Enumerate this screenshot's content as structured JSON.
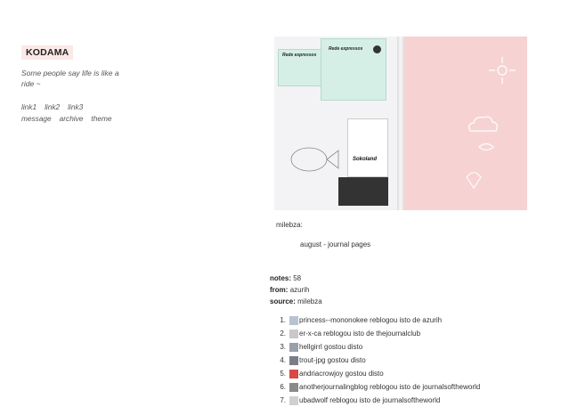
{
  "sidebar": {
    "title": "KODAMA",
    "description": "Some people say life is like a ride ~",
    "links_row1": [
      "link1",
      "link2",
      "link3"
    ],
    "links_row2": [
      "message",
      "archive",
      "theme"
    ]
  },
  "post": {
    "ticket_brand": "Rede expressos",
    "signature": "Sokoland",
    "author": "milebza:",
    "caption": "august - journal pages",
    "colors": {
      "right_page": "#f6d3d2",
      "ticket": "#d5efe6"
    }
  },
  "meta": {
    "notes_label": "notes:",
    "notes_value": "58",
    "from_label": "from:",
    "from_value": "azurih",
    "source_label": "source:",
    "source_value": "milebza"
  },
  "notes": [
    {
      "num": "1.",
      "text": "princess--mononokee reblogou isto de azurih",
      "avatar": "#b9c3d0"
    },
    {
      "num": "2.",
      "text": "er-x-ca reblogou isto de thejournalclub",
      "avatar": "#c8c8c8"
    },
    {
      "num": "3.",
      "text": "hellgirrl gostou disto",
      "avatar": "#9aa0a8"
    },
    {
      "num": "4.",
      "text": "trout-jpg gostou disto",
      "avatar": "#7a7f86"
    },
    {
      "num": "5.",
      "text": "andriacrowjoy gostou disto",
      "avatar": "#d84848"
    },
    {
      "num": "6.",
      "text": "anotherjournalingblog reblogou isto de journalsoftheworld",
      "avatar": "#8a8a8a"
    },
    {
      "num": "7.",
      "text": "ubadwolf reblogou isto de journalsoftheworld",
      "avatar": "#d0d0d0"
    }
  ]
}
